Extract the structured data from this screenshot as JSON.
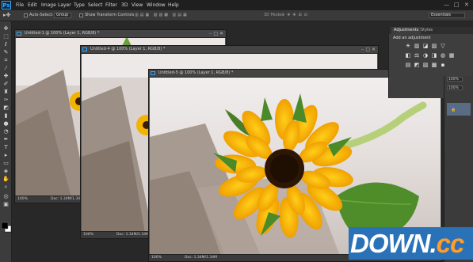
{
  "app": {
    "logo": "Ps",
    "menu": [
      "File",
      "Edit",
      "Image",
      "Layer",
      "Type",
      "Select",
      "Filter",
      "3D",
      "View",
      "Window",
      "Help"
    ],
    "window_controls": [
      "—",
      "□",
      "✕"
    ]
  },
  "options": {
    "auto_select_label": "Auto-Select:",
    "group_value": "Group",
    "show_transform_label": "Show Transform Controls",
    "mode_3d_label": "3D Mode:",
    "workspace_value": "Essentials"
  },
  "documents": [
    {
      "title": "Untitled-1 @ 100% (Layer 1, RGB/8) *",
      "zoom": "100%",
      "doc_info": "Doc: 1.34M/1.34M"
    },
    {
      "title": "Untitled-4 @ 100% (Layer 1, RGB/8) *",
      "zoom": "100%",
      "doc_info": "Doc: 1.34M/1.34M"
    },
    {
      "title": "Untitled-5 @ 100% (Layer 1, RGB/8) *",
      "zoom": "100%",
      "doc_info": "Doc: 1.34M/1.34M"
    }
  ],
  "panel": {
    "tab_adjustments": "Adjustments",
    "tab_styles": "Styles",
    "hint": "Add an adjustment",
    "icons_row1": [
      "☀",
      "▥",
      "◪",
      "▨",
      "▽"
    ],
    "icons_row2": [
      "◧",
      "⚖",
      "◑",
      "◨",
      "◍",
      "▦"
    ],
    "icons_row3": [
      "▤",
      "◩",
      "▧",
      "▩",
      "▪"
    ]
  },
  "side": {
    "opacity": "100%",
    "fill": "100%"
  },
  "colors": {
    "accent": "#31a8ff",
    "watermark_bg": "#2a72b8",
    "watermark_cc": "#ff9c2a"
  },
  "watermark": {
    "down": "DOWN",
    "dot": ".",
    "cc": "cc"
  }
}
